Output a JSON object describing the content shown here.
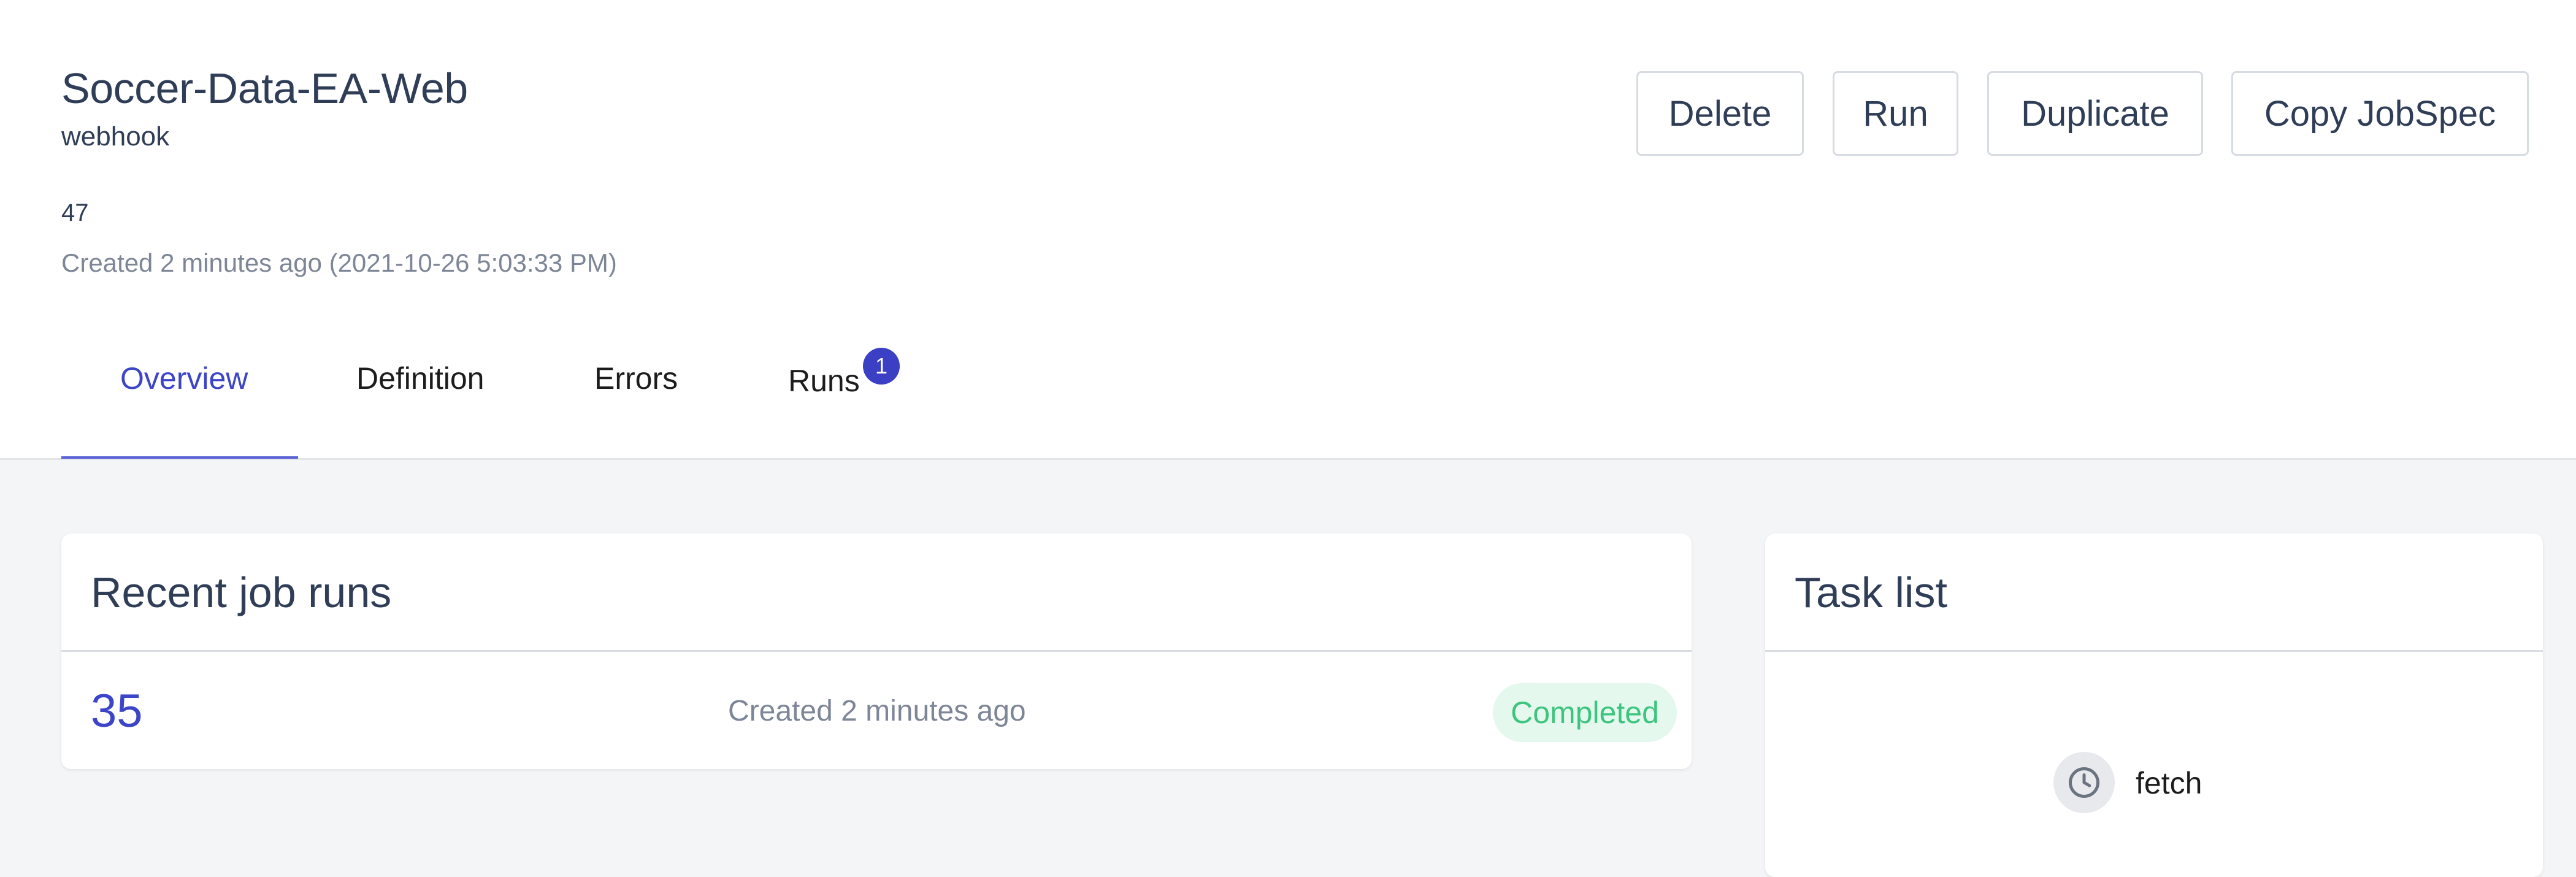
{
  "job": {
    "title": "Soccer-Data-EA-Web",
    "type": "webhook",
    "id": "47",
    "created": "Created 2 minutes ago (2021-10-26 5:03:33 PM)"
  },
  "actions": {
    "delete": "Delete",
    "run": "Run",
    "duplicate": "Duplicate",
    "copy_jobspec": "Copy JobSpec"
  },
  "tabs": [
    {
      "label": "Overview",
      "active": true
    },
    {
      "label": "Definition"
    },
    {
      "label": "Errors"
    },
    {
      "label": "Runs",
      "badge": "1"
    }
  ],
  "recent_runs": {
    "title": "Recent job runs",
    "rows": [
      {
        "id": "35",
        "created": "Created 2 minutes ago",
        "status": "Completed"
      }
    ]
  },
  "task_list": {
    "title": "Task list",
    "tasks": [
      {
        "name": "fetch",
        "icon": "clock-icon"
      }
    ]
  },
  "colors": {
    "accent": "#3c45c7",
    "text": "#2f3d56",
    "muted": "#7d8696",
    "success": "#3dc47e",
    "success_bg": "#e4f8ee",
    "page_bg": "#f4f5f7"
  }
}
